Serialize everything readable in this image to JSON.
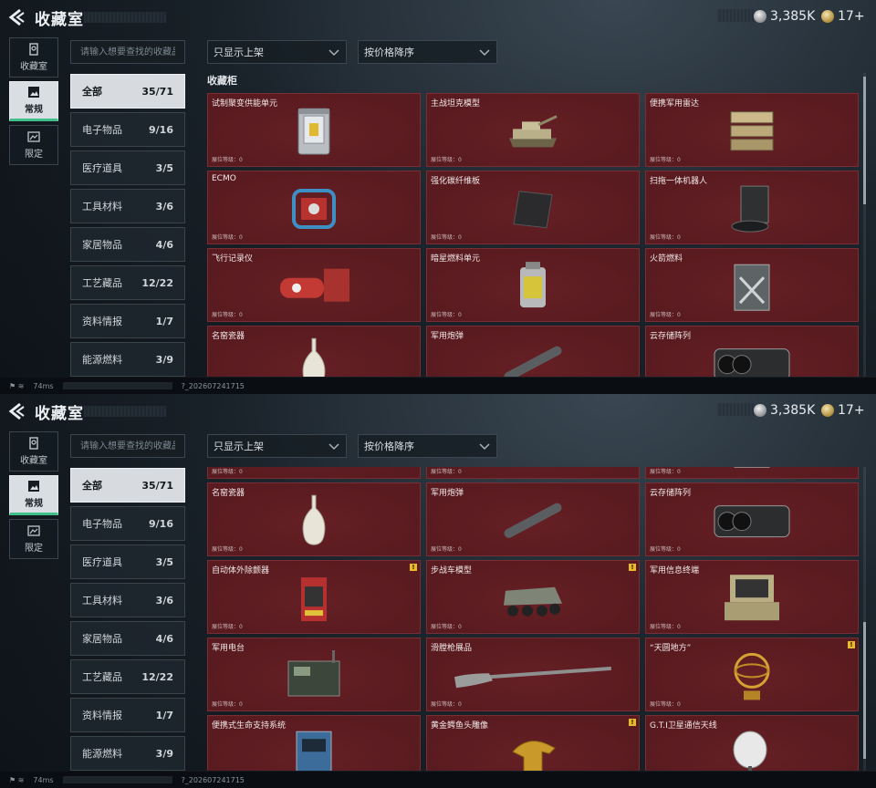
{
  "header": {
    "title": "收藏室",
    "currency_silver": "3,385K",
    "currency_gold": "17+"
  },
  "nav": [
    {
      "label": "收藏室",
      "icon": "collection-icon"
    },
    {
      "label": "常规",
      "icon": "picture-icon",
      "active": true
    },
    {
      "label": "限定",
      "icon": "limited-icon"
    }
  ],
  "search": {
    "placeholder": "请输入想要查找的收藏品"
  },
  "filters": {
    "shelf": "只显示上架",
    "sort": "按价格降序"
  },
  "categories": [
    {
      "label": "全部",
      "count": "35/71"
    },
    {
      "label": "电子物品",
      "count": "9/16"
    },
    {
      "label": "医疗道具",
      "count": "3/5"
    },
    {
      "label": "工具材料",
      "count": "3/6"
    },
    {
      "label": "家居物品",
      "count": "4/6"
    },
    {
      "label": "工艺藏品",
      "count": "12/22"
    },
    {
      "label": "资料情报",
      "count": "1/7"
    },
    {
      "label": "能源燃料",
      "count": "3/9"
    }
  ],
  "section_title": "收藏柜",
  "level_label": "展位等级：0",
  "items": [
    {
      "name": "试制聚变供能单元",
      "icon": "fusion-cell-icon"
    },
    {
      "name": "主战坦克模型",
      "icon": "tank-model-icon"
    },
    {
      "name": "便携军用雷达",
      "icon": "radar-icon"
    },
    {
      "name": "ECMO",
      "icon": "ecmo-icon"
    },
    {
      "name": "强化碳纤维板",
      "icon": "carbon-plate-icon"
    },
    {
      "name": "扫拖一体机器人",
      "icon": "robot-vacuum-icon"
    },
    {
      "name": "飞行记录仪",
      "icon": "flight-recorder-icon"
    },
    {
      "name": "暗星燃料单元",
      "icon": "fuel-cell-icon"
    },
    {
      "name": "火箭燃料",
      "icon": "rocket-fuel-icon"
    },
    {
      "name": "名窑瓷器",
      "icon": "porcelain-icon"
    },
    {
      "name": "军用炮弹",
      "icon": "shell-icon"
    },
    {
      "name": "云存储阵列",
      "icon": "storage-array-icon"
    },
    {
      "name": "自动体外除颤器",
      "icon": "defibrillator-icon",
      "new": true
    },
    {
      "name": "步战车模型",
      "icon": "ifv-model-icon",
      "new": true
    },
    {
      "name": "军用信息终端",
      "icon": "terminal-icon"
    },
    {
      "name": "军用电台",
      "icon": "radio-icon"
    },
    {
      "name": "滑膛枪展品",
      "icon": "musket-icon"
    },
    {
      "name": "“天圆地方”",
      "icon": "armillary-icon",
      "new": true
    },
    {
      "name": "便携式生命支持系统",
      "icon": "life-support-icon"
    },
    {
      "name": "黄金鳄鱼头雕像",
      "icon": "croc-statue-icon",
      "new": true
    },
    {
      "name": "G.T.I卫星通信天线",
      "icon": "satellite-dish-icon"
    }
  ],
  "new_badge": "!",
  "status": {
    "ping": "74ms",
    "build": "?_202607241715"
  },
  "colors": {
    "card_bg": "#5a1b20",
    "accent_green": "#3fbf8a",
    "badge": "#e8b928"
  }
}
